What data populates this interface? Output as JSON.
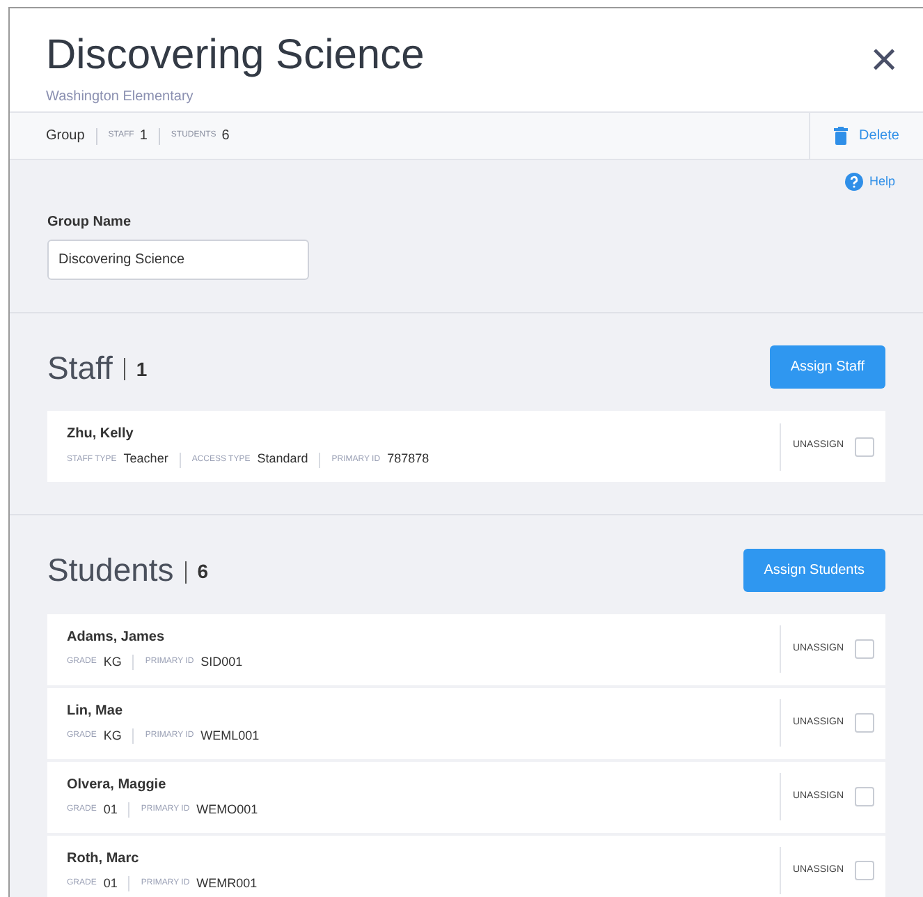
{
  "header": {
    "title": "Discovering Science",
    "subtitle": "Washington Elementary",
    "close": "×"
  },
  "summary": {
    "type": "Group",
    "counts": [
      {
        "label": "STAFF",
        "value": "1"
      },
      {
        "label": "STUDENTS",
        "value": "6"
      }
    ],
    "delete": "Delete"
  },
  "help": "Help",
  "group_name": {
    "label": "Group Name",
    "value": "Discovering Science"
  },
  "sections": [
    {
      "title": "Staff",
      "count": "1",
      "button": "Assign Staff",
      "rows": [
        {
          "name": "Zhu, Kelly",
          "fields": [
            {
              "label": "STAFF TYPE",
              "value": "Teacher"
            },
            {
              "label": "ACCESS TYPE",
              "value": "Standard"
            },
            {
              "label": "PRIMARY ID",
              "value": "787878"
            }
          ],
          "action": "UNASSIGN",
          "checked": false
        }
      ]
    },
    {
      "title": "Students",
      "count": "6",
      "button": "Assign Students",
      "rows": [
        {
          "name": "Adams, James",
          "fields": [
            {
              "label": "GRADE",
              "value": "KG"
            },
            {
              "label": "PRIMARY ID",
              "value": "SID001"
            }
          ],
          "action": "UNASSIGN",
          "checked": false
        },
        {
          "name": "Lin, Mae",
          "fields": [
            {
              "label": "GRADE",
              "value": "KG"
            },
            {
              "label": "PRIMARY ID",
              "value": "WEML001"
            }
          ],
          "action": "UNASSIGN",
          "checked": false
        },
        {
          "name": "Olvera, Maggie",
          "fields": [
            {
              "label": "GRADE",
              "value": "01"
            },
            {
              "label": "PRIMARY ID",
              "value": "WEMO001"
            }
          ],
          "action": "UNASSIGN",
          "checked": false
        },
        {
          "name": "Roth, Marc",
          "fields": [
            {
              "label": "GRADE",
              "value": "01"
            },
            {
              "label": "PRIMARY ID",
              "value": "WEMR001"
            }
          ],
          "action": "UNASSIGN",
          "checked": false
        }
      ]
    }
  ]
}
